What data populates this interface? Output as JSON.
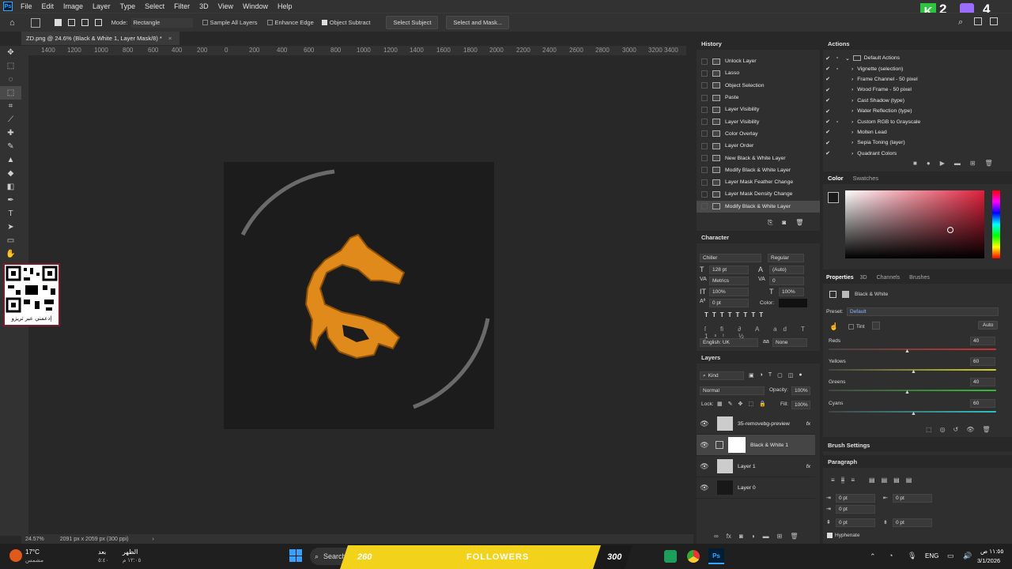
{
  "menubar": {
    "logo": "Ps",
    "items": [
      "File",
      "Edit",
      "Image",
      "Layer",
      "Type",
      "Select",
      "Filter",
      "3D",
      "View",
      "Window",
      "Help"
    ],
    "overlay_counter_left": "2",
    "overlay_counter_right": "4"
  },
  "options_bar": {
    "mode_label": "Mode:",
    "mode_value": "Rectangle",
    "sample_all_layers": "Sample All Layers",
    "enhance_edge": "Enhance Edge",
    "object_subtract": "Object Subtract",
    "select_subject": "Select Subject",
    "select_and_mask": "Select and Mask..."
  },
  "document": {
    "tab_title": "ZD.png @ 24.6% (Black & White 1, Layer Mask/8) *",
    "ruler_labels": [
      "1400",
      "1200",
      "1000",
      "800",
      "600",
      "400",
      "200",
      "0",
      "200",
      "400",
      "600",
      "800",
      "1000",
      "1200",
      "1400",
      "1600",
      "1800",
      "2000",
      "2200",
      "2400",
      "2600",
      "2800",
      "3000",
      "3200",
      "3400"
    ],
    "zoom": "24.57%",
    "size_info": "2091 px x 2059 px (300 ppi)",
    "qr_caption": "إدعمني عبر تريزو"
  },
  "history": {
    "title": "History",
    "items": [
      "Unlock Layer",
      "Lasso",
      "Object Selection",
      "Paste",
      "Layer Visibility",
      "Layer Visibility",
      "Color Overlay",
      "Layer Order",
      "New Black & White Layer",
      "Modify Black & White Layer",
      "Layer Mask Feather Change",
      "Layer Mask Density Change",
      "Modify Black & White Layer"
    ]
  },
  "actions": {
    "title": "Actions",
    "set_name": "Default Actions",
    "items": [
      "Vignette (selection)",
      "Frame Channel - 50 pixel",
      "Wood Frame - 50 pixel",
      "Cast Shadow (type)",
      "Water Reflection (type)",
      "Custom RGB to Grayscale",
      "Molten Lead",
      "Sepia Toning (layer)",
      "Quadrant Colors"
    ]
  },
  "color": {
    "tab_color": "Color",
    "tab_swatches": "Swatches",
    "hue_hex": "#e0203a"
  },
  "character": {
    "title": "Character",
    "font_family": "Chiller",
    "font_style": "Regular",
    "font_size": "128 pt",
    "leading": "(Auto)",
    "kerning": "Metrics",
    "tracking": "0",
    "vertical_scale": "100%",
    "horizontal_scale": "100%",
    "baseline": "0 pt",
    "color_label": "Color:",
    "language": "English: UK",
    "antialias": "None"
  },
  "properties": {
    "tabs": [
      "Properties",
      "3D",
      "Channels",
      "Brushes"
    ],
    "adjustment": "Black & White",
    "preset_label": "Preset:",
    "preset_value": "Default",
    "tint_label": "Tint",
    "auto_label": "Auto",
    "sliders": [
      {
        "name": "Reds",
        "value": "40",
        "fraction": 0.48
      },
      {
        "name": "Yellows",
        "value": "60",
        "fraction": 0.52
      },
      {
        "name": "Greens",
        "value": "40",
        "fraction": 0.48
      },
      {
        "name": "Cyans",
        "value": "60",
        "fraction": 0.52
      }
    ]
  },
  "layers": {
    "title": "Layers",
    "filter_kind": "Kind",
    "blend_mode": "Normal",
    "opacity_label": "Opacity:",
    "opacity_value": "100%",
    "lock_label": "Lock:",
    "fill_label": "Fill:",
    "fill_value": "100%",
    "items": [
      {
        "name": "35-removebg-preview",
        "fx": "fx"
      },
      {
        "name": "Black & White 1",
        "fx": ""
      },
      {
        "name": "Layer 1",
        "fx": "fx"
      },
      {
        "name": "Layer 0",
        "fx": ""
      }
    ]
  },
  "brush_settings": {
    "title": "Brush Settings"
  },
  "paragraph": {
    "title": "Paragraph",
    "indent_left": "0 pt",
    "indent_right": "0 pt",
    "indent_first": "0 pt",
    "space_before": "0 pt",
    "space_after": "0 pt",
    "hyphenate": "Hyphenate"
  },
  "taskbar": {
    "temperature": "17°C",
    "weather_caption": "مشمس",
    "prayer_caption_1": "بعد",
    "prayer_time_1": "٥:٤٠",
    "prayer_caption_2": "الظهر",
    "prayer_time_2": "١٢:٠٥ م",
    "search_text": "Search",
    "overlay_left_number": "260",
    "overlay_center_text": "FOLLOWERS",
    "overlay_right_number": "300",
    "language": "ENG",
    "clock_time": "١١:٥٥ ص",
    "clock_date": "3/1/2026"
  }
}
